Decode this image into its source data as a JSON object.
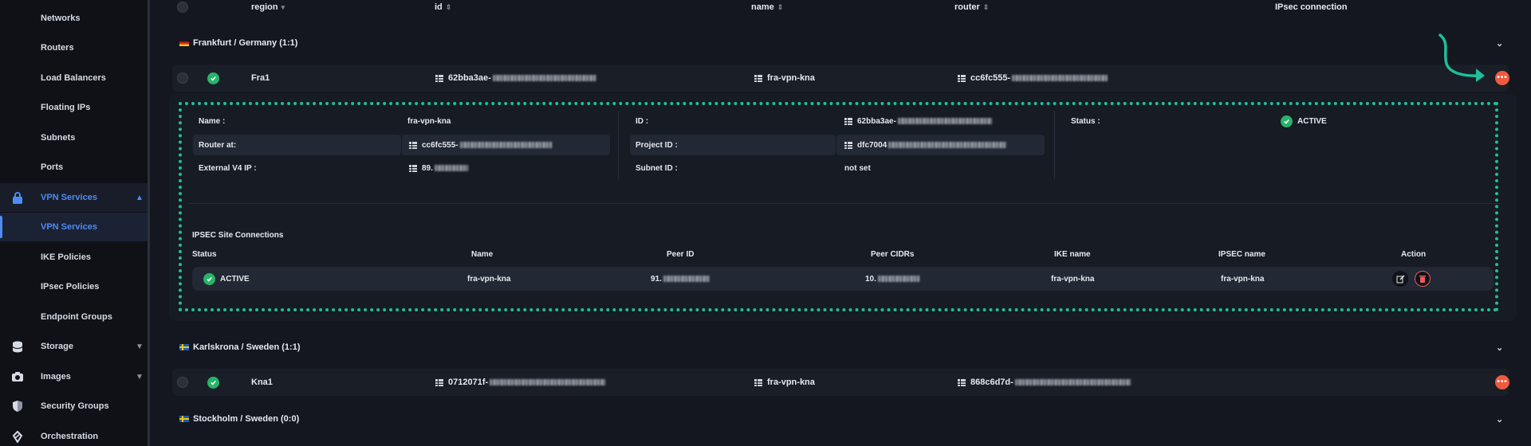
{
  "sidebar": {
    "items": [
      {
        "label": "Networks"
      },
      {
        "label": "Routers"
      },
      {
        "label": "Load Balancers"
      },
      {
        "label": "Floating IPs"
      },
      {
        "label": "Subnets"
      },
      {
        "label": "Ports"
      },
      {
        "label": "VPN Services",
        "icon": "lock-icon",
        "expanded": true
      },
      {
        "label": "VPN Services",
        "active": true
      },
      {
        "label": "IKE Policies"
      },
      {
        "label": "IPsec Policies"
      },
      {
        "label": "Endpoint Groups"
      },
      {
        "label": "Storage",
        "icon": "database-icon"
      },
      {
        "label": "Images",
        "icon": "camera-icon"
      },
      {
        "label": "Security Groups",
        "icon": "shield-icon"
      },
      {
        "label": "Orchestration",
        "icon": "orchestration-icon"
      }
    ]
  },
  "table": {
    "headers": {
      "region": "region",
      "id": "id",
      "name": "name",
      "router": "router",
      "ipsec": "IPsec connection"
    }
  },
  "groups": [
    {
      "title": "Frankfurt / Germany (1:1)",
      "flag": "germany-flag"
    },
    {
      "title": "Karlskrona / Sweden (1:1)",
      "flag": "sweden-flag"
    },
    {
      "title": "Stockholm / Sweden (0:0)",
      "flag": "sweden-flag"
    }
  ],
  "rows": [
    {
      "region": "Fra1",
      "id": "62bba3ae-",
      "name": "fra-vpn-kna",
      "router": "cc6fc555-"
    },
    {
      "region": "Kna1",
      "id": "0712071f-",
      "name": "fra-vpn-kna",
      "router": "868c6d7d-"
    }
  ],
  "detail": {
    "name_label": "Name :",
    "name_value": "fra-vpn-kna",
    "router_label": "Router at:",
    "router_value": "cc6fc555-",
    "ext_label": "External V4 IP :",
    "ext_value": "89.",
    "id_label": "ID :",
    "id_value": "62bba3ae-",
    "project_label": "Project ID :",
    "project_value": "dfc7004",
    "subnet_label": "Subnet ID :",
    "subnet_value": "not set",
    "status_label": "Status :",
    "status_value": "ACTIVE"
  },
  "ipsec": {
    "title": "IPSEC Site Connections",
    "headers": {
      "status": "Status",
      "name": "Name",
      "peer_id": "Peer ID",
      "peer_cidrs": "Peer CIDRs",
      "ike": "IKE name",
      "ipsec_name": "IPSEC name",
      "action": "Action"
    },
    "row": {
      "status": "ACTIVE",
      "name": "fra-vpn-kna",
      "peer_id": "91.",
      "peer_cidrs": "10.",
      "ike": "fra-vpn-kna",
      "ipsec_name": "fra-vpn-kna"
    }
  },
  "colors": {
    "accent": "#4d8cf5",
    "success": "#27b46a",
    "danger": "#ef5a3f",
    "highlight": "#1fbf9a"
  }
}
